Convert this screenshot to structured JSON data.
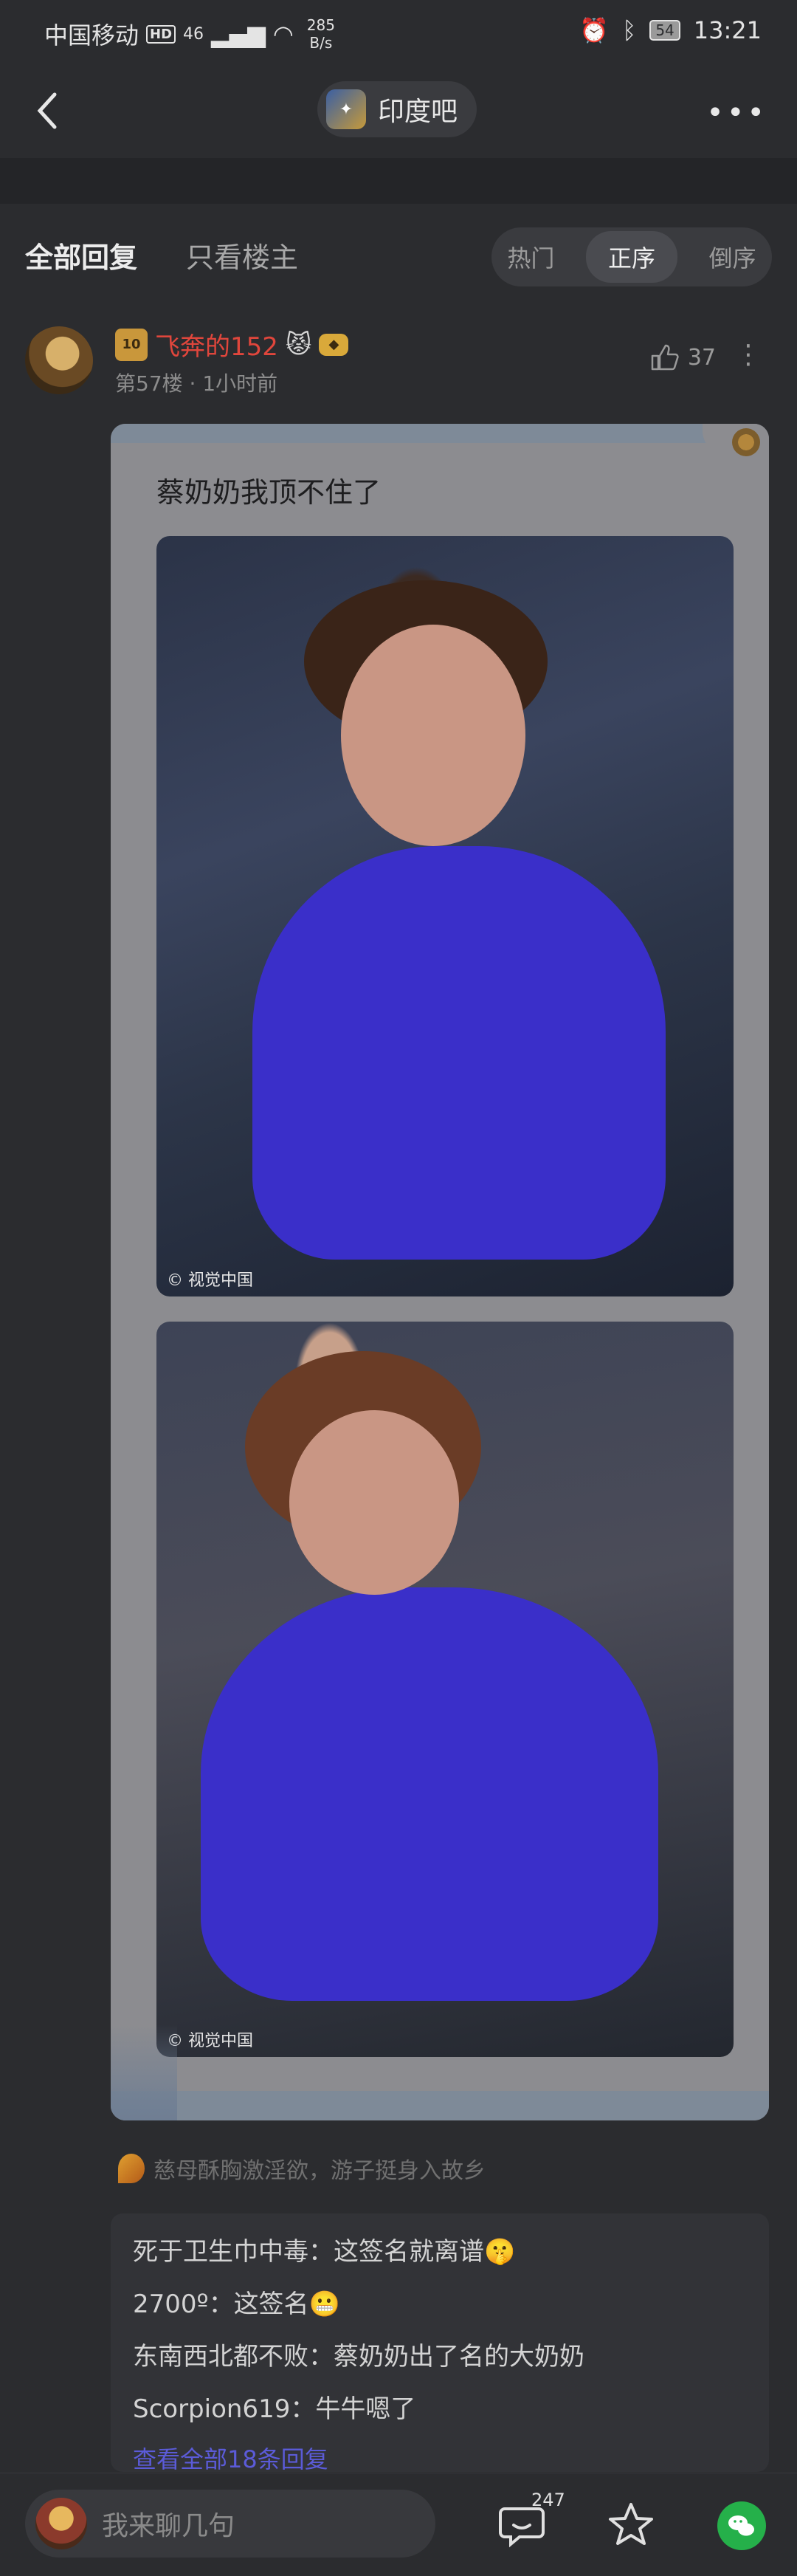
{
  "status_bar": {
    "carrier": "中国移动",
    "hd": "HD",
    "signal": "46",
    "speed_value": "285",
    "speed_unit": "B/s",
    "battery": "54",
    "time": "13:21"
  },
  "navbar": {
    "forum_name": "印度吧",
    "more_label": "•••"
  },
  "tabs": {
    "all_replies": "全部回复",
    "op_only": "只看楼主",
    "sort_options": [
      "热门",
      "正序",
      "倒序"
    ],
    "sort_selected": "正序"
  },
  "post": {
    "level_badge": "10",
    "username": "飞奔的152",
    "username_emoji": "😾",
    "floor": "第57楼",
    "separator": "·",
    "time_ago": "1小时前",
    "likes": "37",
    "text": "蔡奶奶我顶不住了",
    "image_watermark": "© 视觉中国",
    "signature": "慈母酥胸激淫欲，游子挺身入故乡"
  },
  "replies": [
    {
      "user": "死于卫生巾中毒",
      "text": "这签名就离谱",
      "emoji": "🤫"
    },
    {
      "user": "2700º",
      "text": "这签名",
      "emoji": "😬"
    },
    {
      "user": "东南西北都不败",
      "text": "蔡奶奶出了名的大奶奶",
      "emoji": ""
    },
    {
      "user": "Scorpion619",
      "text": "牛牛嗯了",
      "emoji": ""
    }
  ],
  "see_all": "查看全部18条回复",
  "bottom_bar": {
    "placeholder": "我来聊几句",
    "comment_count": "247"
  },
  "colors": {
    "background": "#2b2c2f",
    "username_red": "#e0463c",
    "link_purple": "#5b5bd8",
    "dress_blue": "#3a2fc9",
    "wechat_green": "#25b04a"
  }
}
